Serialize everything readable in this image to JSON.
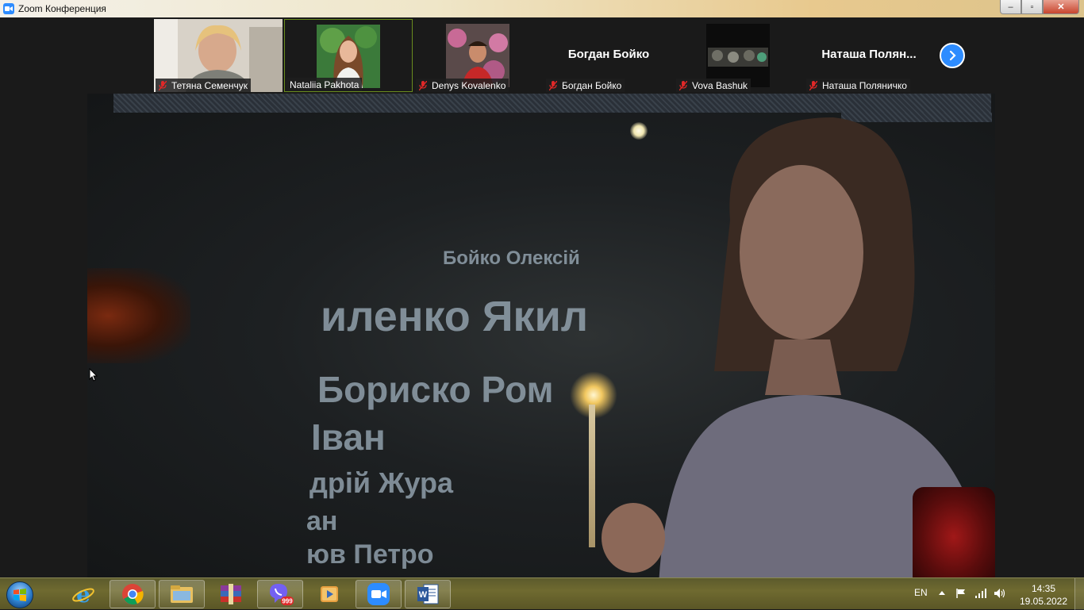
{
  "window": {
    "title": "Zoom Конференция",
    "controls": {
      "minimize": "‒",
      "maximize": "▫",
      "close": "✕"
    }
  },
  "participants": [
    {
      "name": "Тетяна Семенчук",
      "muted": true,
      "has_video": true
    },
    {
      "name": "Nataliia Pakhota",
      "muted": false,
      "has_video": true,
      "active": true
    },
    {
      "name": "Denys Kovalenko",
      "muted": true,
      "has_video": true
    },
    {
      "name": "Богдан Бойко",
      "display": "Богдан Бойко",
      "muted": true,
      "has_video": false
    },
    {
      "name": "Vova Bashuk",
      "muted": true,
      "has_video": true
    },
    {
      "name": "Наташа Поляничко",
      "display": "Наташа  Полян...",
      "muted": true,
      "has_video": false
    }
  ],
  "video": {
    "wall_text": [
      "Бойко Олексій",
      "иленко Якил",
      "Бориско Ром",
      "Іван",
      "дрій  Жура",
      "ан",
      "юв Петро"
    ]
  },
  "taskbar": {
    "apps": [
      "start",
      "internet-explorer",
      "chrome",
      "file-explorer",
      "winrar",
      "viber",
      "media-player",
      "zoom",
      "word"
    ],
    "viber_badge": "999",
    "language": "EN",
    "time": "14:35",
    "date": "19.05.2022"
  },
  "colors": {
    "zoom_blue": "#2d8cff",
    "active_tile_border": "#6a8c1e",
    "mic_off": "#e02828"
  }
}
